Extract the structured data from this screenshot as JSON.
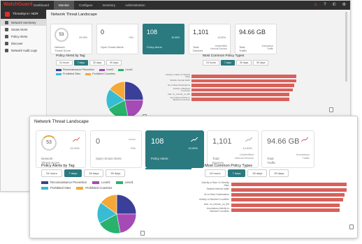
{
  "app": {
    "logo_text": "WatchGuard",
    "nav_tabs": [
      "Dashboard",
      "Monitor",
      "Configure",
      "Inventory",
      "Administration"
    ],
    "active_tab_index": 1,
    "product_name": "ThreatSync+ NDR"
  },
  "sidebar": {
    "items": [
      {
        "label": "Network Summary",
        "active": true
      },
      {
        "label": "Smart Alerts",
        "active": false
      },
      {
        "label": "Policy Alerts",
        "active": false
      },
      {
        "label": "Discover",
        "active": false
      },
      {
        "label": "Network Audit Logs",
        "active": false
      }
    ]
  },
  "page": {
    "title": "Network Threat Landscape"
  },
  "cards": [
    {
      "value": "53",
      "label_line1": "Network",
      "label_line2": "Threat Score",
      "pct": "20.25%",
      "sub1": "",
      "sub2": "",
      "highlighted": false
    },
    {
      "value": "0",
      "label_line1": "Open Smart Alerts",
      "label_line2": "",
      "pct": "+0%",
      "sub1": "",
      "sub2": "",
      "highlighted": false
    },
    {
      "value": "108",
      "label_line1": "Policy Alerts",
      "label_line2": "",
      "pct": "10.00%",
      "sub1": "",
      "sub2": "",
      "highlighted": true
    },
    {
      "value": "1,101",
      "label_line1": "Total",
      "label_line2": "Devices",
      "pct": "14.92%",
      "sub1": "Unidentified",
      "sub2": "Internal Devices",
      "highlighted": false
    },
    {
      "value": "94.66 GB",
      "label_line1": "Total",
      "label_line2": "Traffic",
      "pct": "",
      "sub1": "Anomalous",
      "sub2": "Traffic",
      "highlighted": false
    }
  ],
  "policy_alerts_by_tag": {
    "title": "Policy Alerts by Tag",
    "ranges": [
      "24 hours",
      "7 days",
      "30 days",
      "90 days"
    ],
    "selected_range_index": 1,
    "legend": [
      {
        "name": "Reconnaissance Prevention",
        "color": "#3a3f99"
      },
      {
        "name": "Level3",
        "color": "#a64ab6"
      },
      {
        "name": "Level1",
        "color": "#28b26b"
      },
      {
        "name": "Prohibited Sites",
        "color": "#38bcd4"
      },
      {
        "name": "Prohibited Countries",
        "color": "#f4a836"
      }
    ]
  },
  "chart_data": [
    {
      "type": "pie",
      "title": "Policy Alerts by Tag",
      "categories": [
        "Reconnaissance Prevention",
        "Level3",
        "Level1",
        "Prohibited Sites",
        "Prohibited Countries"
      ],
      "values": [
        25,
        22,
        20,
        18,
        15
      ],
      "colors": [
        "#3a3f99",
        "#a64ab6",
        "#28b26b",
        "#38bcd4",
        "#f4a836"
      ]
    },
    {
      "type": "bar",
      "orientation": "horizontal",
      "title": "Most Common Policy Types",
      "categories": [
        "Activity to Rare Or Weekly Sites",
        "Sizable Internal traffic",
        "Go to Rare Destinations",
        "Activity to Blocked Countries",
        "Add. on_remote_no_BS",
        "Anomalous Activity to Blocked Countries"
      ],
      "values": [
        96,
        96,
        94,
        93,
        90,
        90
      ],
      "xlim": [
        0,
        100
      ],
      "color": "#d9605a"
    }
  ],
  "most_common_policy_types": {
    "title": "Most Common Policy Types",
    "ranges": [
      "24 hours",
      "7 days",
      "30 days",
      "90 days"
    ],
    "selected_range_index": 1
  },
  "icons": {
    "alert": "alert-icon",
    "help": "help-icon",
    "phone": "phone-icon",
    "settings": "settings-icon",
    "export": "export-icon"
  }
}
